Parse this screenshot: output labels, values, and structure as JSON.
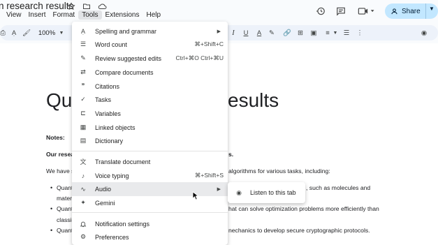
{
  "doc": {
    "title": "n research results",
    "heading_left": "Qu",
    "heading_right": "esults",
    "notes_label": "Notes:",
    "bold_line_left": "Our resea",
    "bold_line_right": "s.",
    "line2_left": "We have s",
    "line2_right": "algorithms for various tasks, including:",
    "bullet1_left": "Quant",
    "bullet1_right": ", such as molecules and",
    "bullet1_cont": "materi",
    "bullet2_left": "Quant",
    "bullet2_right": "hat can solve optimization problems more efficiently than",
    "bullet2_cont": "classic",
    "bullet3_left": "Quant",
    "bullet3_right": "nechanics to develop secure cryptographic protocols.",
    "bullet_glyph": "•"
  },
  "menubar": {
    "items": [
      "View",
      "Insert",
      "Format",
      "Tools",
      "Extensions",
      "Help"
    ]
  },
  "share": {
    "label": "Share"
  },
  "toolbar": {
    "zoom": "100%"
  },
  "tools_menu": {
    "items": [
      {
        "label": "Spelling and grammar",
        "shortcut": "",
        "icon": "spellcheck-icon",
        "glyph": "Ạ",
        "submenu": true
      },
      {
        "label": "Word count",
        "shortcut": "⌘+Shift+C",
        "icon": "word-count-icon",
        "glyph": "☰"
      },
      {
        "label": "Review suggested edits",
        "shortcut": "Ctrl+⌘O Ctrl+⌘U",
        "icon": "review-edits-icon",
        "glyph": "✎"
      },
      {
        "label": "Compare documents",
        "shortcut": "",
        "icon": "compare-icon",
        "glyph": "⇄"
      },
      {
        "label": "Citations",
        "shortcut": "",
        "icon": "citations-icon",
        "glyph": "❞"
      },
      {
        "label": "Tasks",
        "shortcut": "",
        "icon": "tasks-icon",
        "glyph": "✓"
      },
      {
        "label": "Variables",
        "shortcut": "",
        "icon": "variables-icon",
        "glyph": "⊏"
      },
      {
        "label": "Linked objects",
        "shortcut": "",
        "icon": "linked-objects-icon",
        "glyph": "▦"
      },
      {
        "label": "Dictionary",
        "shortcut": "",
        "icon": "dictionary-icon",
        "glyph": "▤"
      },
      {
        "label": "Translate document",
        "shortcut": "",
        "icon": "translate-icon",
        "glyph": "文"
      },
      {
        "label": "Voice typing",
        "shortcut": "⌘+Shift+S",
        "icon": "microphone-icon",
        "glyph": "♪"
      },
      {
        "label": "Audio",
        "shortcut": "",
        "icon": "audio-icon",
        "glyph": "∿",
        "submenu": true
      },
      {
        "label": "Gemini",
        "shortcut": "",
        "icon": "gemini-icon",
        "glyph": "✦"
      },
      {
        "label": "Notification settings",
        "shortcut": "",
        "icon": "bell-icon",
        "glyph": "🔔"
      },
      {
        "label": "Preferences",
        "shortcut": "",
        "icon": "preferences-icon",
        "glyph": "⚙"
      }
    ]
  },
  "audio_submenu": {
    "items": [
      {
        "label": "Listen to this tab",
        "icon": "listen-icon",
        "glyph": "◉"
      }
    ]
  },
  "colors": {
    "share_bg": "#c2e7ff",
    "menu_highlight": "#e9eaec",
    "toolbar_bg": "#edf2fa"
  }
}
